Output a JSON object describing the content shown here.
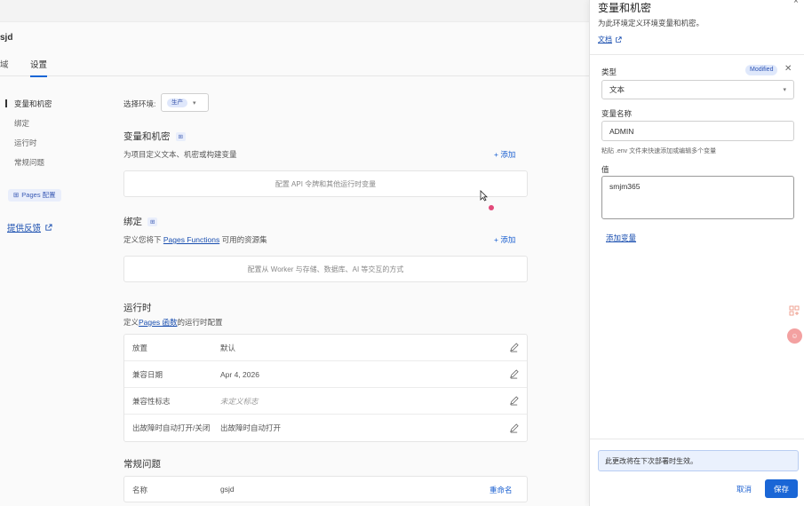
{
  "project": {
    "title": "sjd"
  },
  "tabs": [
    {
      "label": "域"
    },
    {
      "label": "设置"
    }
  ],
  "sidebar": {
    "items": [
      {
        "label": "变量和机密"
      },
      {
        "label": "绑定"
      },
      {
        "label": "运行时"
      },
      {
        "label": "常规问题"
      }
    ],
    "pages_config": "Pages 配置",
    "feedback": "提供反馈"
  },
  "env": {
    "label": "选择环境:",
    "selected": "生产"
  },
  "sections": {
    "vars": {
      "title": "变量和机密",
      "desc": "为项目定义文本、机密或构建变量",
      "add": "+ 添加",
      "empty": "配置 API 令牌和其他运行时变量"
    },
    "bindings": {
      "title": "绑定",
      "desc_pre": "定义您将下",
      "desc_link": "Pages Functions",
      "desc_post": "可用的资源集",
      "add": "+ 添加",
      "empty": "配置从 Worker 与存储、数据库、AI 等交互的方式"
    },
    "runtime": {
      "title": "运行时",
      "desc_pre": "定义",
      "desc_link": "Pages 函数",
      "desc_post": "的运行时配置",
      "rows": [
        {
          "key": "放置",
          "value": "默认",
          "muted": false
        },
        {
          "key": "兼容日期",
          "value": "Apr 4, 2026",
          "muted": false
        },
        {
          "key": "兼容性标志",
          "value": "未定义标志",
          "muted": true
        },
        {
          "key": "出故障时自动打开/关闭",
          "value": "出故障时自动打开",
          "muted": false
        }
      ]
    },
    "faq": {
      "title": "常规问题",
      "name_key": "名称",
      "name_value": "gsjd",
      "rename": "重命名"
    }
  },
  "drawer": {
    "title": "变量和机密",
    "subtitle": "为此环境定义环境变量和机密。",
    "doc_link": "文档",
    "type_label": "类型",
    "modified_badge": "Modified",
    "type_value": "文本",
    "name_label": "变量名称",
    "name_value": "ADMIN",
    "hint": "粘贴 .env 文件来快速添加或编辑多个变量",
    "value_label": "值",
    "value_value": "smjm365",
    "add_var": "添加变量",
    "note": "此更改将在下次部署时生效。",
    "cancel": "取消",
    "save": "保存"
  }
}
